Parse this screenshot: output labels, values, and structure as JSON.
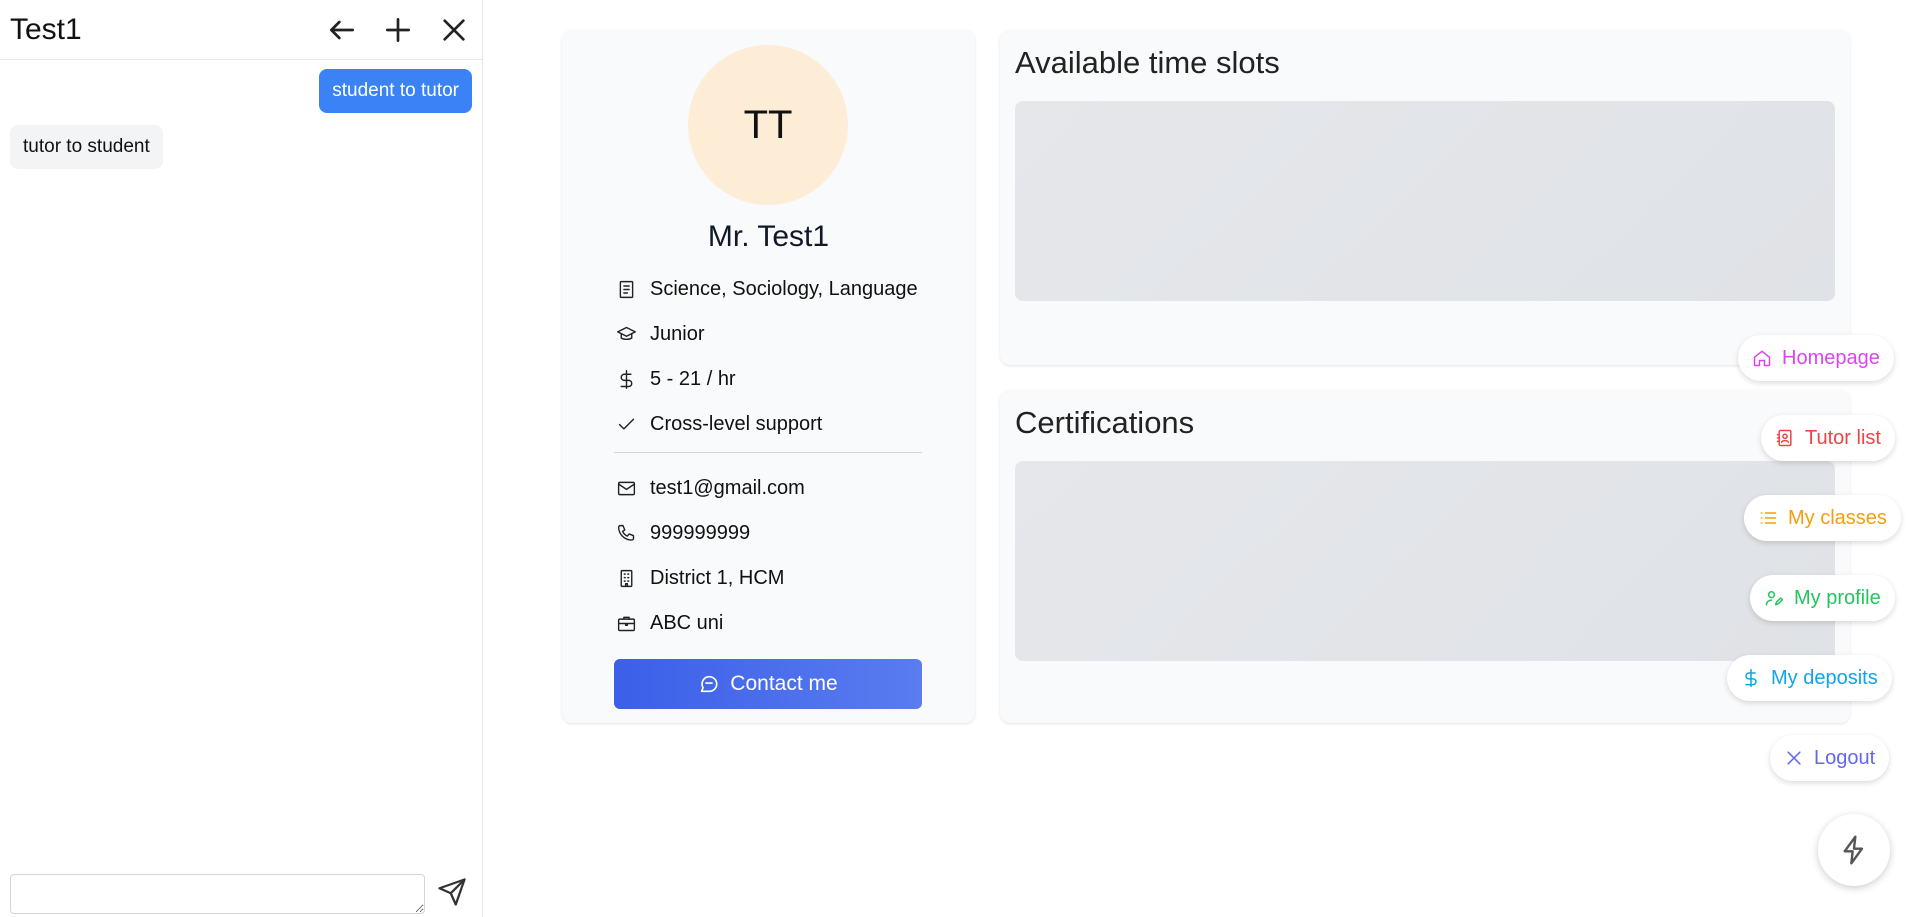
{
  "chat": {
    "title": "Test1",
    "messages": [
      {
        "direction": "outgoing",
        "text": "student to tutor"
      },
      {
        "direction": "incoming",
        "text": "tutor to student"
      }
    ],
    "input_value": ""
  },
  "profile": {
    "initials": "TT",
    "name": "Mr. Test1",
    "subjects": "Science, Sociology, Language",
    "level": "Junior",
    "price": "5 - 21 / hr",
    "feature": "Cross-level support",
    "email": "test1@gmail.com",
    "phone": "999999999",
    "address": "District 1, HCM",
    "school": "ABC uni",
    "contact_label": "Contact me"
  },
  "sections": {
    "time_slots_title": "Available time slots",
    "certifications_title": "Certifications"
  },
  "menu": {
    "items": [
      {
        "label": "Homepage",
        "icon": "home-icon",
        "color": "#d946ef"
      },
      {
        "label": "Tutor list",
        "icon": "contact-book-icon",
        "color": "#ef4444"
      },
      {
        "label": "My classes",
        "icon": "list-icon",
        "color": "#f59e0b"
      },
      {
        "label": "My profile",
        "icon": "user-edit-icon",
        "color": "#22c55e"
      },
      {
        "label": "My deposits",
        "icon": "dollar-icon",
        "color": "#0ea5e9"
      },
      {
        "label": "Logout",
        "icon": "close-icon",
        "color": "#6366f1"
      }
    ],
    "toggle_icon": "lightning-icon"
  },
  "colors": {
    "accent": "#3b5fe8",
    "chat_outgoing": "#3b82f6",
    "avatar_bg": "#fdecd6"
  }
}
